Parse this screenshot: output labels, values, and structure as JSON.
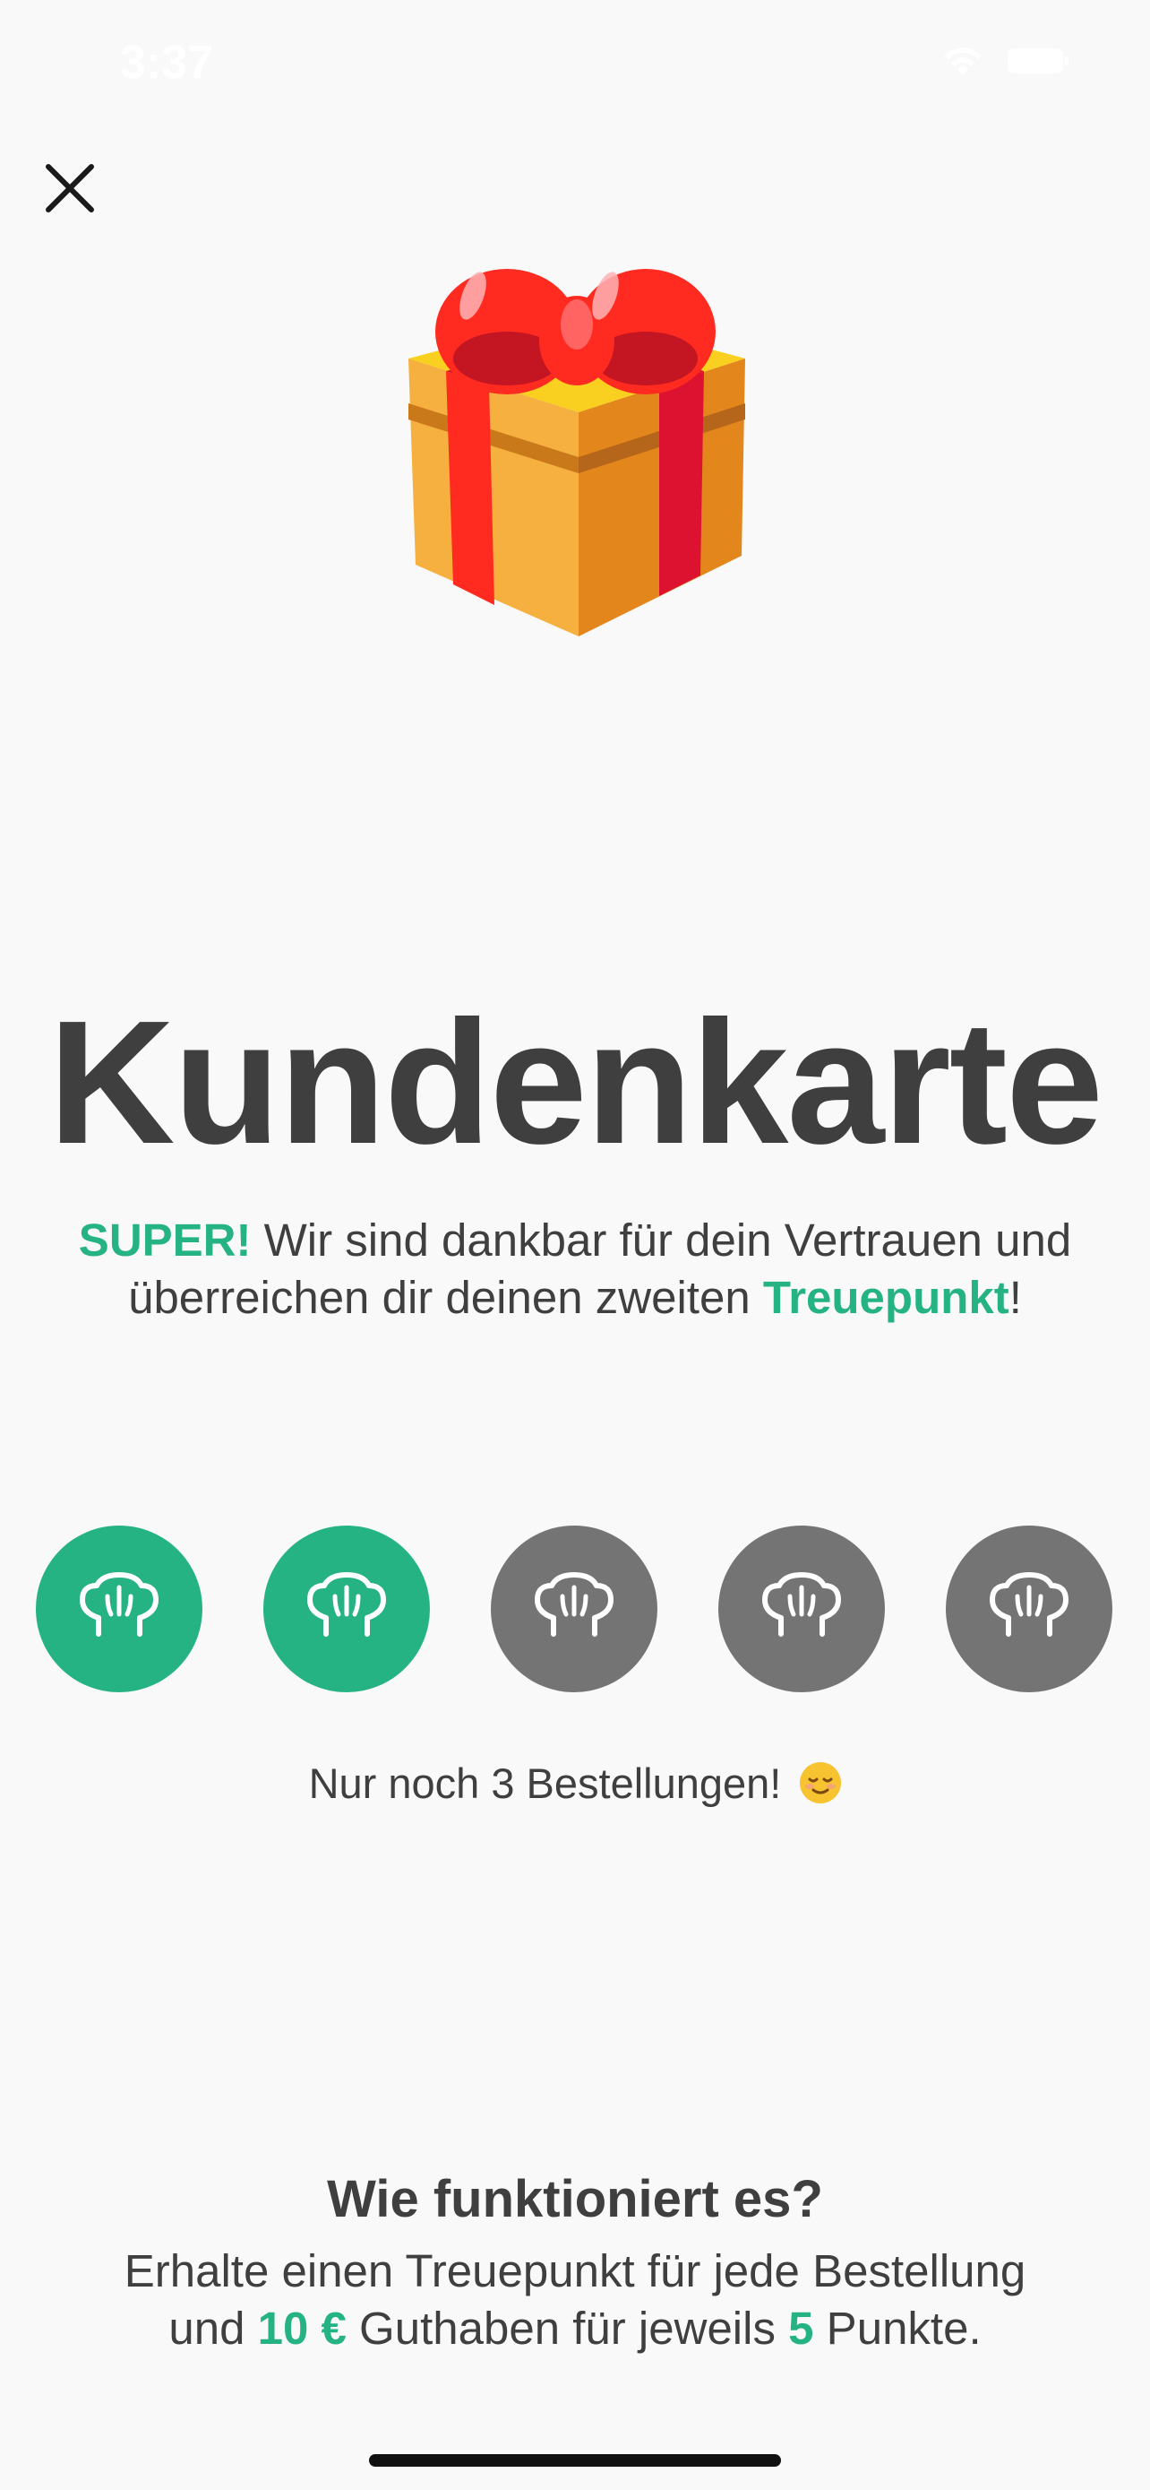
{
  "status_bar": {
    "time": "3:37",
    "icons": [
      "wifi-icon",
      "battery-icon"
    ]
  },
  "close_icon": "close-icon",
  "gift_icon": "gift-icon",
  "title": "Kundenkarte",
  "message": {
    "highlight": "SUPER!",
    "text": " Wir sind dankbar für dein Vertrauen und überreichen dir deinen zweiten ",
    "point_word": "Treuepunkt",
    "end": "!"
  },
  "points": {
    "earned": 2,
    "total": 5,
    "icon": "chef-hat-icon"
  },
  "remaining_text": "Nur noch 3 Bestellungen!",
  "remaining_emoji": "relieved-face-emoji",
  "how": {
    "title": "Wie funktioniert es?",
    "line1": "Erhalte einen Treuepunkt für jede Bestellung",
    "line2_prefix": "und ",
    "amount": "10 €",
    "line2_mid": " Guthaben für jeweils ",
    "points_needed": "5",
    "line2_suffix": " Punkte."
  },
  "colors": {
    "accent": "#26b384",
    "pending": "#747474",
    "text": "#3f3f3f",
    "background": "#f9f9f9"
  }
}
